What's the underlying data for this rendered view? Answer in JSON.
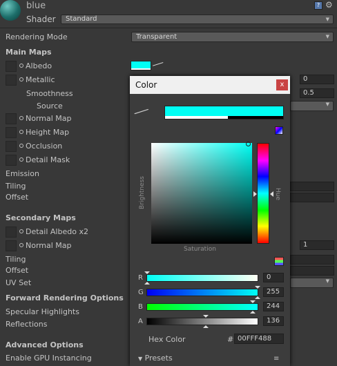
{
  "header": {
    "material_name": "blue",
    "shader_label": "Shader",
    "shader_value": "Standard"
  },
  "rows": {
    "rendering_mode_label": "Rendering Mode",
    "rendering_mode_value": "Transparent",
    "main_maps": "Main Maps",
    "albedo": "Albedo",
    "metallic": "Metallic",
    "metallic_value": "0",
    "smoothness": "Smoothness",
    "smoothness_value": "0.5",
    "source": "Source",
    "normal_map": "Normal Map",
    "height_map": "Height Map",
    "occlusion": "Occlusion",
    "detail_mask": "Detail Mask",
    "emission": "Emission",
    "tiling": "Tiling",
    "offset": "Offset",
    "secondary_maps": "Secondary Maps",
    "detail_albedo": "Detail Albedo x2",
    "normal_map_2": "Normal Map",
    "normal_map_2_value": "1",
    "tiling_2": "Tiling",
    "offset_2": "Offset",
    "uv_set": "UV Set",
    "forward_rendering": "Forward Rendering Options",
    "specular_highlights": "Specular Highlights",
    "reflections": "Reflections",
    "advanced_options": "Advanced Options",
    "gpu_instancing": "Enable GPU Instancing"
  },
  "picker": {
    "title": "Color",
    "close": "x",
    "brightness_label": "Brightness",
    "hue_label": "Hue",
    "saturation_label": "Saturation",
    "channels": [
      {
        "label": "R",
        "value": "0"
      },
      {
        "label": "G",
        "value": "255"
      },
      {
        "label": "B",
        "value": "244"
      },
      {
        "label": "A",
        "value": "136"
      }
    ],
    "hex_label": "Hex Color",
    "hex_hash": "#",
    "hex_value": "00FFF488",
    "presets": "Presets"
  },
  "colors": {
    "current_color": "#00fff4",
    "panel_bg": "#383838",
    "picker_bg": "#3c3c3c"
  },
  "icons": [
    "eyedropper-icon",
    "close-icon",
    "help-icon",
    "gear-icon",
    "color-wheel-icon",
    "slider-mode-icon",
    "dropdown-arrow-icon"
  ]
}
